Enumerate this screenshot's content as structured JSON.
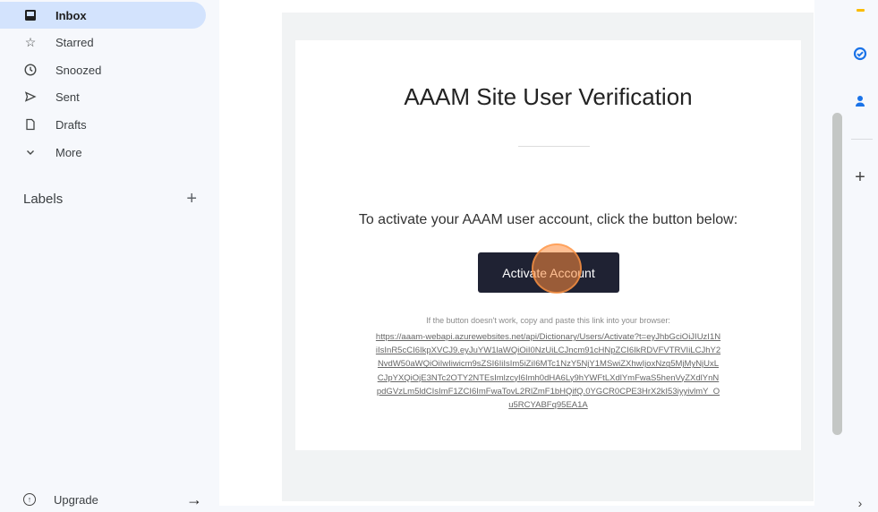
{
  "sidebar": {
    "items": [
      {
        "label": "Inbox",
        "icon": "inbox-icon",
        "active": true
      },
      {
        "label": "Starred",
        "icon": "star-icon"
      },
      {
        "label": "Snoozed",
        "icon": "clock-icon"
      },
      {
        "label": "Sent",
        "icon": "send-icon"
      },
      {
        "label": "Drafts",
        "icon": "draft-icon"
      },
      {
        "label": "More",
        "icon": "chevron-down-icon"
      }
    ],
    "labels_heading": "Labels",
    "upgrade_label": "Upgrade"
  },
  "email": {
    "title": "AAAM Site User Verification",
    "instruction": "To activate your AAAM user account, click the button below:",
    "button_label": "Activate Account",
    "fallback_note": "If the button doesn't work, copy and paste this link into your browser:",
    "link_lines": [
      "https://aaam-webapi.azurewebsites.net/api/Dictionary/Users/Activate?t=eyJhbGciOiJIUzI1N",
      "iIsInR5cCI6IkpXVCJ9.eyJuYW1laWQiOiI0NzUiLCJncm91cHNpZCI6IkRDVFVTRVIiLCJhY2",
      "NvdW50aWQiOiIwIiwicm9sZSI6IiIsIm5iZiI6MTc1NzY5NjY1MSwiZXhwIjoxNzg5MjMyNjUxL",
      "CJpYXQiOjE3NTc2OTY2NTEsImlzcyI6Imh0dHA6Ly9hYWFtLXdlYmFwaS5henVyZXdlYnN",
      "pdGVzLm5ldCIsImF1ZCI6ImFwaTovL2RlZmF1bHQifQ.0YGCR0CPE3HrX2kI53iyyivlmY_O",
      "u5RCYABFq95EA1A"
    ]
  },
  "colors": {
    "button_bg": "#1f2233",
    "active_nav_bg": "#d3e3fd",
    "click_marker": "#ff8c3c",
    "tasks_icon": "#1a73e8",
    "keep_icon": "#fbbc04"
  }
}
